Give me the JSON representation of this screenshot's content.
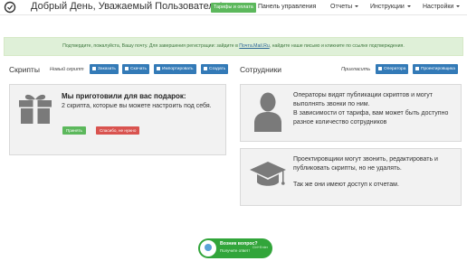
{
  "header": {
    "greeting": "Добрый День, Уважаемый Пользователь!",
    "tariffs_button": "Тарифы и оплата",
    "menu": [
      {
        "label": "Панель управления"
      },
      {
        "label": "Отчеты"
      },
      {
        "label": "Инструкции"
      },
      {
        "label": "Настройки"
      }
    ]
  },
  "alert": {
    "text_before": "Подтвердите, пожалуйста, Вашу почту. Для завершения регистрации: зайдите в ",
    "link": "Почта.Mail.Ru",
    "text_after": ", найдите наше письмо и кликните по ссылке подтверждения."
  },
  "scripts": {
    "title": "Скрипты",
    "new_label": "Новый скрипт",
    "buttons": [
      {
        "label": "Заказать"
      },
      {
        "label": "Скачать"
      },
      {
        "label": "Импортировать"
      },
      {
        "label": "Создать"
      }
    ],
    "gift": {
      "title": "Мы приготовили для вас подарок:",
      "text": "2 скрипта, которые вы можете настроить под себя.",
      "apply": "Принять",
      "decline": "Спасибо, не нужно"
    }
  },
  "employees": {
    "title": "Сотрудники",
    "invite_label": "Пригласить",
    "buttons": [
      {
        "label": "Оператора"
      },
      {
        "label": "Проектировщика"
      }
    ],
    "operators": {
      "p1": "Операторы видят публикации скриптов и могут выполнять звонки по ним.",
      "p2": "В зависимости от тарифа, вам может быть доступно разное количество сотрудников"
    },
    "designers": {
      "p1": "Проектировщики могут звонить, редактировать и публиковать скрипты, но не удалять.",
      "p2": "Так же они имеют доступ к отчетам."
    }
  },
  "help_widget": {
    "title": "Возник вопрос?",
    "subtitle": "Получите ответ!",
    "hint": "Ctrl+Enter"
  },
  "colors": {
    "primary": "#337ab7",
    "success": "#5cb85c",
    "danger": "#d9534f",
    "alert_bg": "#dff0d8",
    "widget": "#32a53a"
  }
}
